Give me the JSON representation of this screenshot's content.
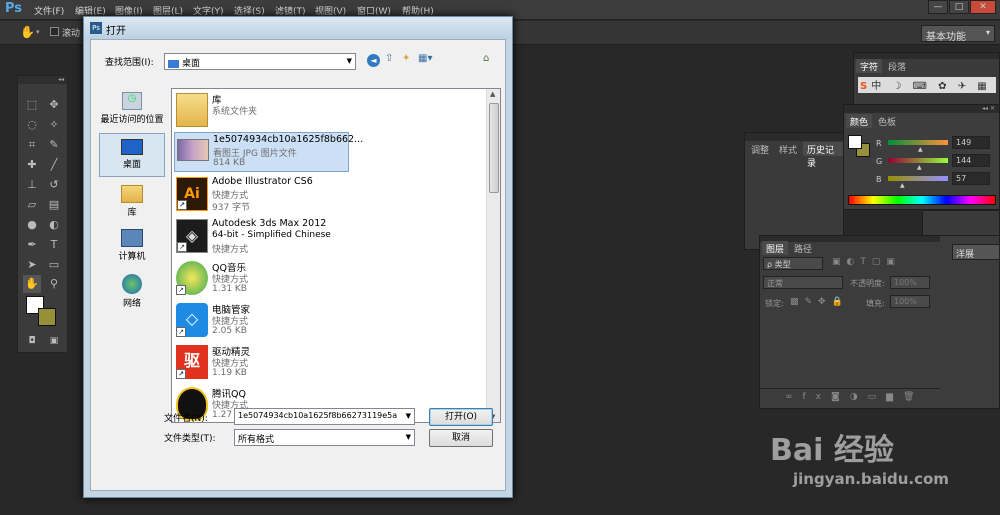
{
  "app": {
    "logo": "Ps"
  },
  "menu": [
    "文件(F)",
    "编辑(E)",
    "图像(I)",
    "图层(L)",
    "文字(Y)",
    "选择(S)",
    "滤镜(T)",
    "视图(V)",
    "窗口(W)",
    "帮助(H)"
  ],
  "window_controls": [
    "—",
    "□",
    "✕"
  ],
  "options": {
    "workspace": "基本功能",
    "partial_label": "滚动"
  },
  "panels": {
    "char_tabs": [
      "字符",
      "段落"
    ],
    "color_tabs": [
      "颜色",
      "色板"
    ],
    "color": {
      "r_label": "R",
      "g_label": "G",
      "b_label": "B",
      "r": "149",
      "g": "144",
      "b": "57",
      "fg": "#ffffff",
      "bg": "#959039"
    },
    "history_tabs": [
      "调整",
      "样式",
      "历史记录"
    ],
    "layers_tabs": [
      "图层",
      "路径"
    ],
    "layers": {
      "kind": "ρ 类型",
      "blend": "正常",
      "opacity_label": "不透明度:",
      "opacity": "100%",
      "lock_label": "锁定:",
      "fill_label": "填充:",
      "fill": "100%"
    },
    "partial_right": "洋展"
  },
  "dialog": {
    "title": "打开",
    "lookin_label": "查找范围(I):",
    "lookin_value": "桌面",
    "places": [
      {
        "label": "最近访问的位置",
        "icon": "recent-places-icon"
      },
      {
        "label": "桌面",
        "icon": "desktop-icon"
      },
      {
        "label": "库",
        "icon": "library-icon"
      },
      {
        "label": "计算机",
        "icon": "computer-icon"
      },
      {
        "label": "网络",
        "icon": "network-icon"
      }
    ],
    "files": [
      {
        "name": "库",
        "line2": "系统文件夹",
        "line3": ""
      },
      {
        "name": "1e5074934cb10a1625f8b662...",
        "line2": "看图王 JPG 图片文件",
        "line3": "814 KB"
      },
      {
        "name": "Adobe Illustrator CS6",
        "line2": "快捷方式",
        "line3": "937 字节"
      },
      {
        "name": "Autodesk 3ds Max 2012",
        "line2": "64-bit - Simplified Chinese",
        "line3": "快捷方式"
      },
      {
        "name": "QQ音乐",
        "line2": "快捷方式",
        "line3": "1.31 KB"
      },
      {
        "name": "电脑管家",
        "line2": "快捷方式",
        "line3": "2.05 KB"
      },
      {
        "name": "驱动精灵",
        "line2": "快捷方式",
        "line3": "1.19 KB"
      },
      {
        "name": "腾讯QQ",
        "line2": "快捷方式",
        "line3": "1.27 KB"
      }
    ],
    "filename_label": "文件名(N):",
    "filename_value": "1e5074934cb10a1625f8b66273119e5a",
    "filetype_label": "文件类型(T):",
    "filetype_value": "所有格式",
    "open_button": "打开(O)",
    "cancel_button": "取消"
  },
  "watermark": {
    "brand": "Bai 经验",
    "url": "jingyan.baidu.com"
  }
}
